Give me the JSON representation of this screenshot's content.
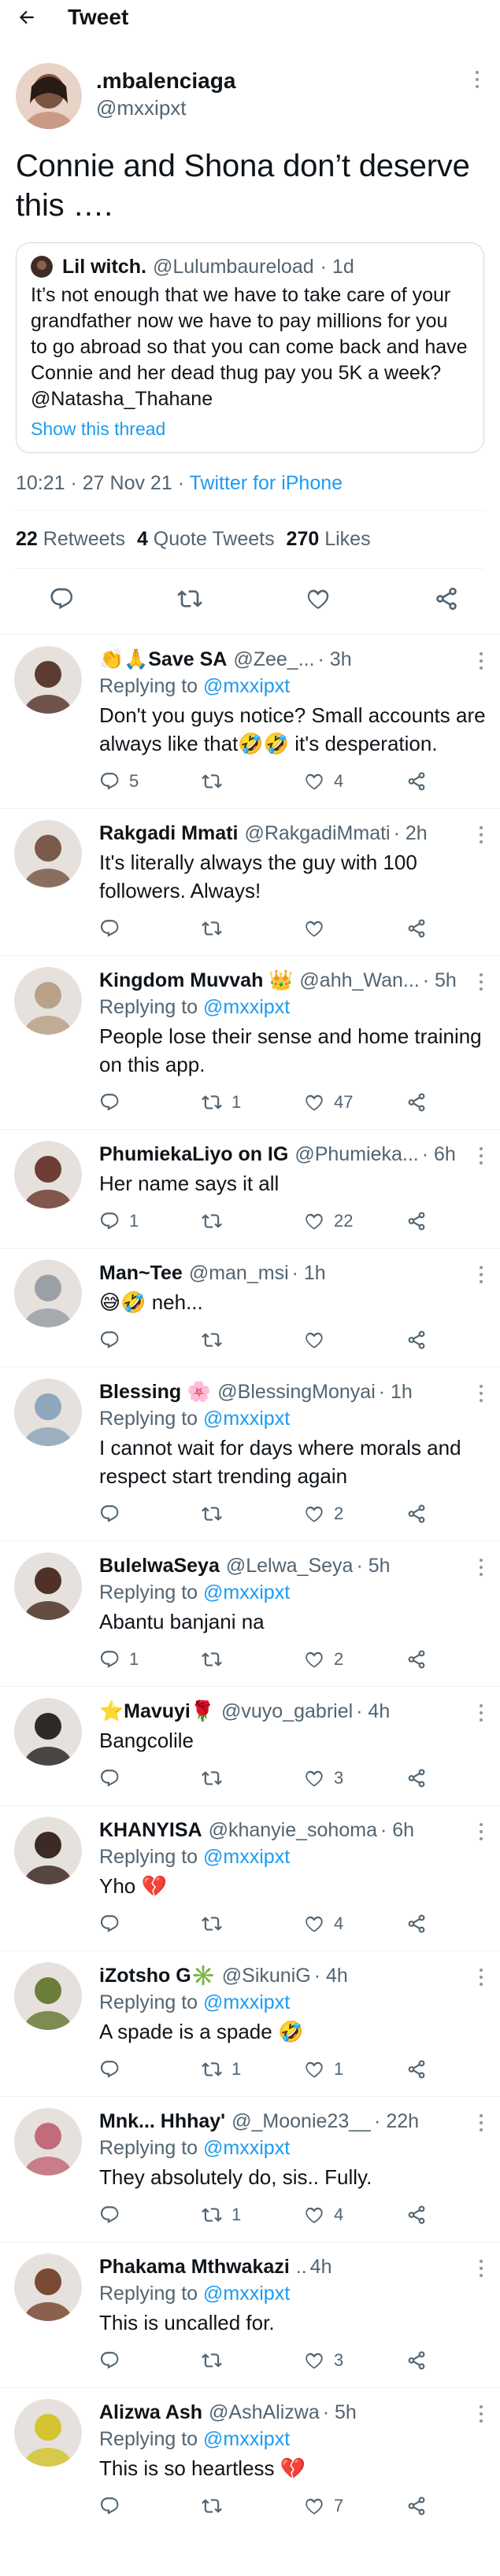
{
  "header": {
    "title": "Tweet"
  },
  "tweet": {
    "name": ".mbalenciaga",
    "handle": "@mxxipxt",
    "text": "Connie and Shona don’t deserve this ….",
    "quote": {
      "name": "Lil witch.",
      "handle": "@Lulumbaureload",
      "time": "· 1d",
      "text": "It’s not enough that we have to take care of your grandfather now we have to pay millions for you to go abroad so that you can come back and have Connie and her dead thug pay you 5K a week? @Natasha_Thahane",
      "show_thread": "Show this thread"
    },
    "timestamp": "10:21 · 27 Nov 21 · ",
    "source": "Twitter for iPhone",
    "stats": {
      "retweets": "22",
      "retweets_label": "Retweets",
      "quotes": "4",
      "quotes_label": "Quote Tweets",
      "likes": "270",
      "likes_label": "Likes"
    }
  },
  "replying_label": "Replying to ",
  "replies": [
    {
      "name": "👏🙏Save SA",
      "handle": "@Zee_...",
      "time": "· 3h",
      "replying_to": "@mxxipxt",
      "text": "Don't you guys notice? Small accounts are always like that🤣🤣 it's desperation.",
      "replies": "5",
      "retweets": "",
      "likes": "4",
      "avatar_color": "#5b3b32"
    },
    {
      "name": "Rakgadi Mmati",
      "handle": "@RakgadiMmati",
      "time": "· 2h",
      "replying_to": "",
      "text": "It's literally always the guy with 100 followers. Always!",
      "replies": "",
      "retweets": "",
      "likes": "",
      "avatar_color": "#7a5a48"
    },
    {
      "name": "Kingdom Muvvah 👑",
      "handle": "@ahh_Wan...",
      "time": "· 5h",
      "replying_to": "@mxxipxt",
      "text": "People lose their sense and home training on this app.",
      "replies": "",
      "retweets": "1",
      "likes": "47",
      "avatar_color": "#b9a18a"
    },
    {
      "name": "PhumiekaLiyo on IG",
      "handle": "@Phumieka...",
      "time": "· 6h",
      "replying_to": "",
      "text": "Her name says it all",
      "replies": "1",
      "retweets": "",
      "likes": "22",
      "avatar_color": "#6e3d33"
    },
    {
      "name": "Man~Tee",
      "handle": "@man_msi",
      "time": "· 1h",
      "replying_to": "",
      "text": "😅🤣 neh...",
      "replies": "",
      "retweets": "",
      "likes": "",
      "avatar_color": "#9aa0a6"
    },
    {
      "name": "Blessing 🌸",
      "handle": "@BlessingMonyai",
      "time": "· 1h",
      "replying_to": "@mxxipxt",
      "text": "I cannot wait for days where morals and respect start trending again",
      "replies": "",
      "retweets": "",
      "likes": "2",
      "avatar_color": "#8fa7bd"
    },
    {
      "name": "BulelwaSeya",
      "handle": "@Lelwa_Seya",
      "time": "· 5h",
      "replying_to": "@mxxipxt",
      "text": "Abantu banjani na",
      "replies": "1",
      "retweets": "",
      "likes": "2",
      "avatar_color": "#4e3128"
    },
    {
      "name": "⭐Mavuyi🌹",
      "handle": "@vuyo_gabriel",
      "time": "· 4h",
      "replying_to": "",
      "text": "Bangcolile",
      "replies": "",
      "retweets": "",
      "likes": "3",
      "avatar_color": "#2b2b2b"
    },
    {
      "name": "KHANYISA",
      "handle": "@khanyie_sohoma",
      "time": "· 6h",
      "replying_to": "@mxxipxt",
      "text": "Yho 💔",
      "replies": "",
      "retweets": "",
      "likes": "4",
      "avatar_color": "#3c2a25"
    },
    {
      "name": "iZotsho G✳️",
      "handle": "@SikuniG",
      "time": "· 4h",
      "replying_to": "@mxxipxt",
      "text": "A spade is a spade 🤣",
      "replies": "",
      "retweets": "1",
      "likes": "1",
      "avatar_color": "#6b7d3a"
    },
    {
      "name": "Mnk... Hhhay'",
      "handle": "@_Moonie23__",
      "time": "· 22h",
      "replying_to": "@mxxipxt",
      "text": "They absolutely do, sis.. Fully.",
      "replies": "",
      "retweets": "1",
      "likes": "4",
      "avatar_color": "#c26b7a"
    },
    {
      "name": "Phakama Mthwakazi",
      "handle": "..",
      "time": "4h",
      "replying_to": "@mxxipxt",
      "text": "This is uncalled for.",
      "replies": "",
      "retweets": "",
      "likes": "3",
      "avatar_color": "#7a4a35"
    },
    {
      "name": "Alizwa Ash",
      "handle": "@AshAlizwa",
      "time": "· 5h",
      "replying_to": "@mxxipxt",
      "text": "This is so heartless 💔",
      "replies": "",
      "retweets": "",
      "likes": "7",
      "avatar_color": "#d4c431"
    }
  ]
}
